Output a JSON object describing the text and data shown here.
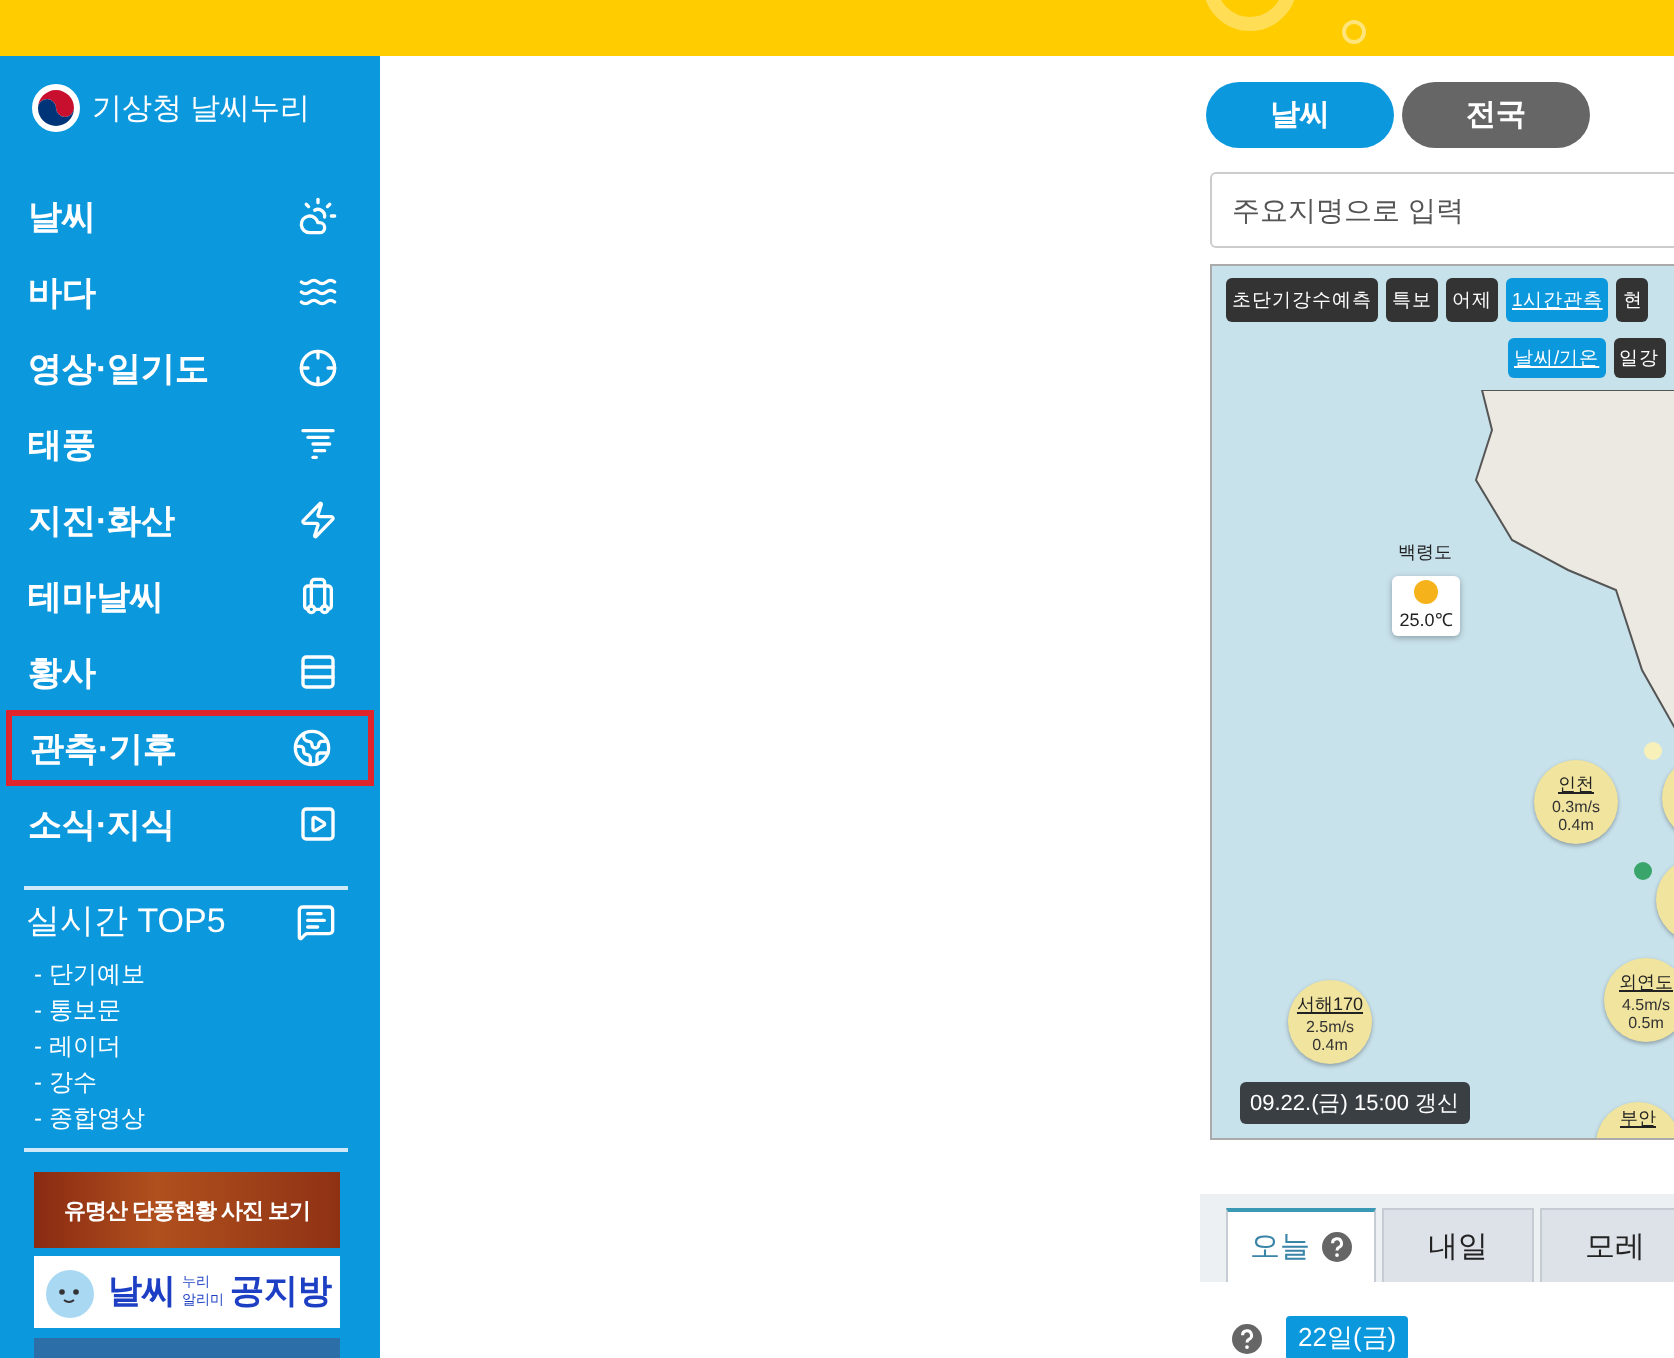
{
  "logo": {
    "title": "기상청 날씨누리"
  },
  "nav": {
    "items": [
      {
        "label": "날씨",
        "highlighted": false
      },
      {
        "label": "바다",
        "highlighted": false
      },
      {
        "label": "영상·일기도",
        "highlighted": false
      },
      {
        "label": "태풍",
        "highlighted": false
      },
      {
        "label": "지진·화산",
        "highlighted": false
      },
      {
        "label": "테마날씨",
        "highlighted": false
      },
      {
        "label": "황사",
        "highlighted": false
      },
      {
        "label": "관측·기후",
        "highlighted": true
      },
      {
        "label": "소식·지식",
        "highlighted": false
      }
    ]
  },
  "top5": {
    "title": "실시간 TOP5",
    "items": [
      "- 단기예보",
      "- 통보문",
      "- 레이더",
      "- 강수",
      "- 종합영상"
    ]
  },
  "banners": {
    "autumn": "유명산 단풍현황 사진 보기",
    "notice": {
      "main": "날씨",
      "small_top": "누리",
      "small_bottom": "알리미",
      "title": "공지방"
    }
  },
  "mode_tabs": [
    {
      "label": "날씨",
      "selected": true
    },
    {
      "label": "전국",
      "selected": false
    }
  ],
  "search": {
    "placeholder": "주요지명으로 입력"
  },
  "map": {
    "layer_buttons": [
      {
        "label": "초단기강수예측",
        "selected": false
      },
      {
        "label": "특보",
        "selected": false
      },
      {
        "label": "어제",
        "selected": false
      },
      {
        "label": "1시간관측",
        "selected": true
      },
      {
        "label": "현",
        "selected": false
      }
    ],
    "sub_buttons": [
      {
        "label": "날씨/기온",
        "selected": true
      },
      {
        "label": "일강",
        "selected": false
      }
    ],
    "weather_card": {
      "name": "백령도",
      "temp": "25.0℃"
    },
    "stations": [
      {
        "name": "인천",
        "wind": "0.3",
        "wind_unit": "m/s",
        "wave": "0.4",
        "wave_unit": "m"
      },
      {
        "name": "서해170",
        "wind": "2.5",
        "wind_unit": "m/s",
        "wave": "0.4",
        "wave_unit": "m"
      },
      {
        "name": "외연도",
        "wind": "4.5",
        "wind_unit": "m/s",
        "wave": "0.5",
        "wave_unit": "m"
      }
    ],
    "edge_station": {
      "name": "부안"
    },
    "updated": "09.22.(금) 15:00 갱신"
  },
  "day_tabs": [
    {
      "label": "오늘",
      "selected": true,
      "help": true
    },
    {
      "label": "내일",
      "selected": false,
      "help": false
    },
    {
      "label": "모레",
      "selected": false,
      "help": false
    }
  ],
  "date_badge": "22일(금)"
}
